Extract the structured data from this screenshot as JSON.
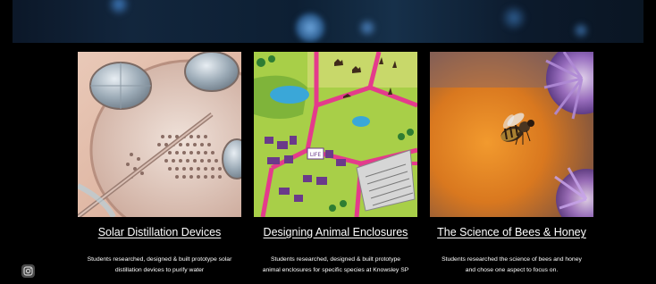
{
  "cards": [
    {
      "title": "Solar Distillation Devices",
      "desc1": "Students researched, designed & built prototype solar",
      "desc2": "distillation devices to purify water",
      "image": "solar-distillation-render"
    },
    {
      "title": "Designing Animal Enclosures",
      "desc1": "Students researched, designed & built prototype",
      "desc2": "animal enclosures for specific species at Knowsley SP",
      "image": "safari-park-map"
    },
    {
      "title": "The Science of Bees & Honey",
      "desc1": "Students researched the science of bees and honey",
      "desc2": "and chose one aspect to focus on.",
      "image": "bee-on-flower-photo"
    }
  ],
  "map_sign": "LIFE",
  "social": {
    "icon": "instagram-icon"
  },
  "colors": {
    "background": "#000000",
    "text": "#ffffff"
  }
}
